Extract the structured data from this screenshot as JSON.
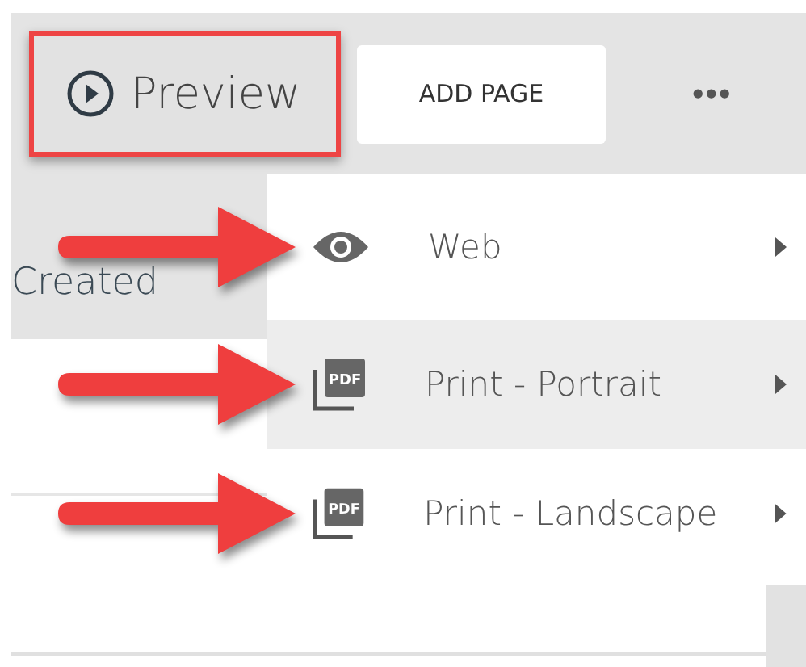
{
  "toolbar": {
    "preview_button": {
      "label": "Preview",
      "highlighted": true
    },
    "add_page_button": {
      "label": "ADD PAGE"
    },
    "more_button": {
      "label": "•••"
    }
  },
  "table": {
    "columns": [
      {
        "label": "Created"
      }
    ]
  },
  "menu": {
    "items": [
      {
        "label": "Web",
        "kind": "eye",
        "selected": false,
        "pointed": true
      },
      {
        "label": "Print - Portrait",
        "kind": "pdf",
        "badge": "PDF",
        "selected": true,
        "pointed": true
      },
      {
        "label": "Print - Landscape",
        "kind": "pdf",
        "badge": "PDF",
        "selected": false,
        "pointed": true
      }
    ]
  }
}
